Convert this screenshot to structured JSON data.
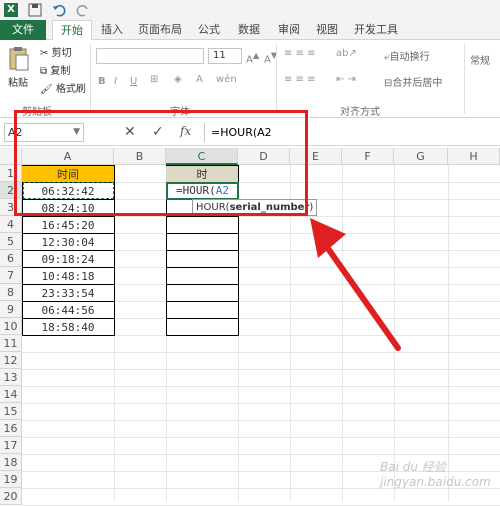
{
  "tabs": [
    "文件",
    "开始",
    "插入",
    "页面布局",
    "公式",
    "数据",
    "审阅",
    "视图",
    "开发工具"
  ],
  "ribbon": {
    "cut": "剪切",
    "copy": "复制",
    "format_painter": "格式刷",
    "paste": "粘贴",
    "clipboard_group": "剪贴板",
    "font_group": "字体",
    "align_group": "对齐方式",
    "font_size": "11",
    "wrap_text": "自动换行",
    "merge_center": "合并后居中",
    "number_format": "常规"
  },
  "formula_bar": {
    "name_box": "A2",
    "formula": "=HOUR(A2"
  },
  "columns": [
    "A",
    "B",
    "C",
    "D",
    "E",
    "F",
    "G",
    "H"
  ],
  "rows": [
    "1",
    "2",
    "3",
    "4",
    "5",
    "6",
    "7",
    "8",
    "9",
    "10",
    "11",
    "12",
    "13",
    "14",
    "15",
    "16",
    "17",
    "18",
    "19",
    "20"
  ],
  "sheet": {
    "a1": "时间",
    "c1": "时",
    "times": [
      "06:32:42",
      "08:24:10",
      "16:45:20",
      "12:30:04",
      "09:18:24",
      "10:48:18",
      "23:33:54",
      "06:44:56",
      "18:58:40"
    ],
    "edit_text": "=HOUR(",
    "edit_ref": "A2",
    "tooltip_fn": "HOUR(",
    "tooltip_arg": "serial_number",
    "tooltip_close": ")"
  },
  "colors": {
    "accent": "#217346",
    "header_fill": "#ffc000",
    "c1_fill": "#ddd9c4",
    "highlight_box": "#e02020"
  },
  "watermark": "Bai du 经验 jingyan.baidu.com"
}
